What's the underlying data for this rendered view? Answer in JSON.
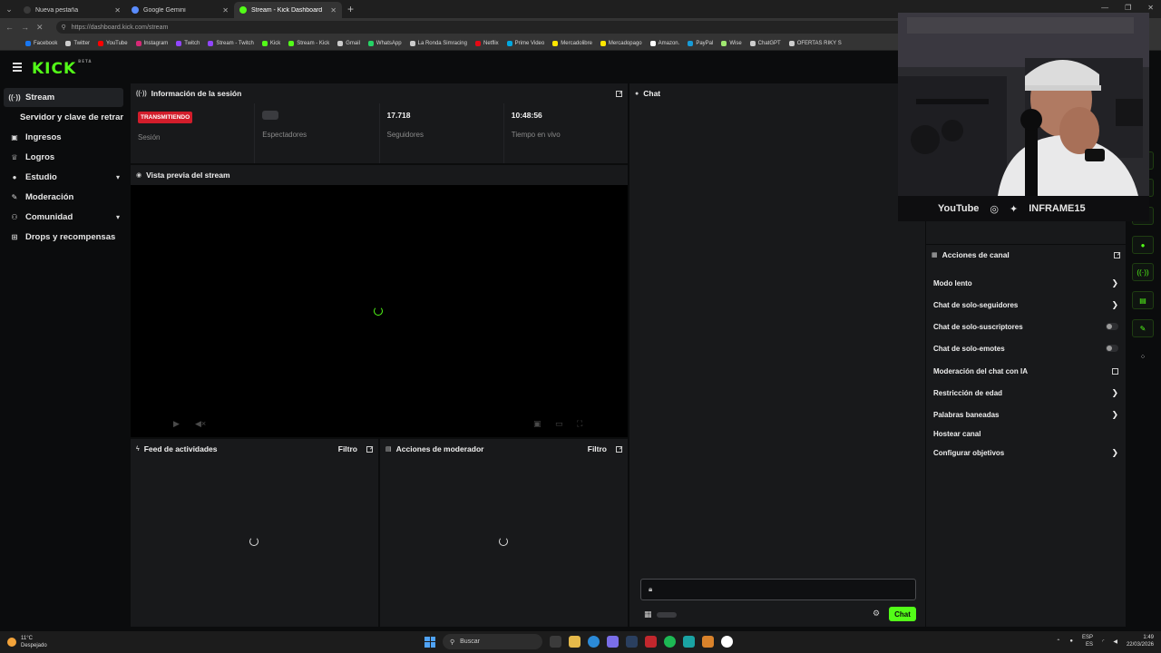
{
  "browser": {
    "tabs": [
      {
        "label": "Nueva pestaña",
        "active": false
      },
      {
        "label": "Google Gemini",
        "active": false
      },
      {
        "label": "Stream - Kick Dashboard",
        "active": true
      }
    ],
    "url": "https://dashboard.kick.com/stream",
    "bookmarks": [
      "Facebook",
      "Twitter",
      "YouTube",
      "Instagram",
      "Twitch",
      "Stream - Twitch",
      "Kick",
      "Stream - Kick",
      "Gmail",
      "WhatsApp",
      "La Ronda Simracing",
      "Netflix",
      "Prime Video",
      "Mercadolibre",
      "Mercadopago",
      "Amazon.",
      "PayPal",
      "Wise",
      "ChatGPT",
      "OFERTAS RIKY S"
    ]
  },
  "brand": {
    "logo": "KICK",
    "logo_sup": "BETA",
    "accent": "#53fc18"
  },
  "sidebar": {
    "items": [
      {
        "label": "Stream",
        "icon": "broadcast-icon"
      },
      {
        "label": "Servidor y clave de retransmisión",
        "icon": ""
      },
      {
        "label": "Ingresos",
        "icon": "wallet-icon"
      },
      {
        "label": "Logros",
        "icon": "trophy-icon"
      },
      {
        "label": "Estudio",
        "icon": "palette-icon"
      },
      {
        "label": "Moderación",
        "icon": "wrench-icon"
      },
      {
        "label": "Comunidad",
        "icon": "people-icon"
      },
      {
        "label": "Drops y recompensas",
        "icon": "gift-icon"
      }
    ]
  },
  "session": {
    "title": "Información de la sesión",
    "status_badge": "TRANSMITIENDO",
    "stats": [
      {
        "label": "Sesión",
        "value": ""
      },
      {
        "label": "Espectadores",
        "value": ""
      },
      {
        "label": "Seguidores",
        "value": "17.718"
      },
      {
        "label": "Tiempo en vivo",
        "value": "10:48:56"
      }
    ]
  },
  "preview": {
    "title": "Vista previa del stream"
  },
  "activity": {
    "title": "Feed de actividades",
    "filter": "Filtro"
  },
  "mod_actions": {
    "title": "Acciones de moderador",
    "filter": "Filtro"
  },
  "chat": {
    "title": "Chat",
    "send_label": "Chat"
  },
  "webcam": {
    "overlay_brand": "YouTube",
    "overlay_name": "INFRAME15"
  },
  "channel_actions": {
    "title": "Acciones de canal",
    "items": [
      {
        "label": "Modo lento",
        "control": "chevron"
      },
      {
        "label": "Chat de solo-seguidores",
        "control": "chevron"
      },
      {
        "label": "Chat de solo-suscriptores",
        "control": "toggle",
        "on": false
      },
      {
        "label": "Chat de solo-emotes",
        "control": "toggle",
        "on": false
      },
      {
        "label": "Moderación del chat con IA",
        "control": "external"
      },
      {
        "label": "Restricción de edad",
        "control": "chevron"
      },
      {
        "label": "Palabras baneadas",
        "control": "chevron"
      },
      {
        "label": "Hostear canal",
        "control": "none"
      },
      {
        "label": "Configurar objetivos",
        "control": "chevron"
      }
    ]
  },
  "taskbar": {
    "weather_temp": "11°C",
    "weather_desc": "Despejado",
    "search_label": "Buscar",
    "lang_top": "ESP",
    "lang_bottom": "ES",
    "time": "1:49",
    "date": "22/03/2026"
  }
}
